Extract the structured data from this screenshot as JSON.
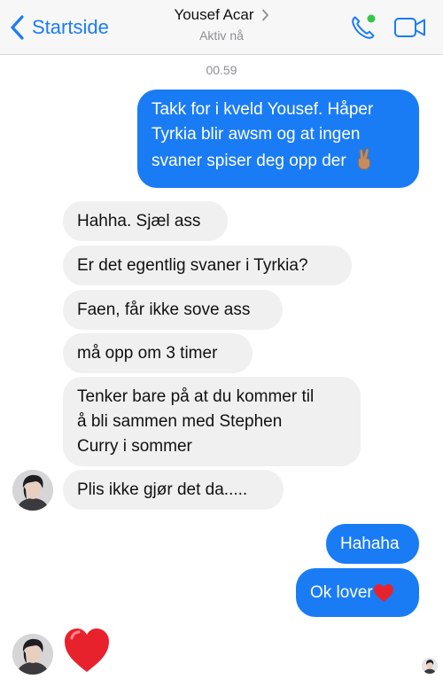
{
  "header": {
    "back_label": "Startside",
    "contact_name": "Yousef Acar",
    "status": "Aktiv nå",
    "accent_color": "#1a7cf5",
    "online_color": "#36c44a"
  },
  "conversation": {
    "timestamp": "00.59",
    "outgoing_1": [
      "Takk for i kveld Yousef. Håper",
      "Tyrkia blir awsm og at ingen",
      "svaner spiser deg opp der"
    ],
    "outgoing_1_emoji": "victory-hand-emoji",
    "incoming_1": "Hahha. Sjæl ass",
    "incoming_2": "Er det egentlig svaner i Tyrkia?",
    "incoming_3": "Faen, får ikke sove ass",
    "incoming_4": "må opp om 3 timer",
    "incoming_5": [
      "Tenker bare på at du kommer til",
      "å bli sammen med Stephen",
      "Curry i sommer"
    ],
    "incoming_6": "Plis ikke gjør det da.....",
    "outgoing_2": "Hahaha",
    "outgoing_3": "Ok lover",
    "outgoing_3_emoji": "red-heart-emoji",
    "big_reaction": "red-heart-emoji"
  }
}
